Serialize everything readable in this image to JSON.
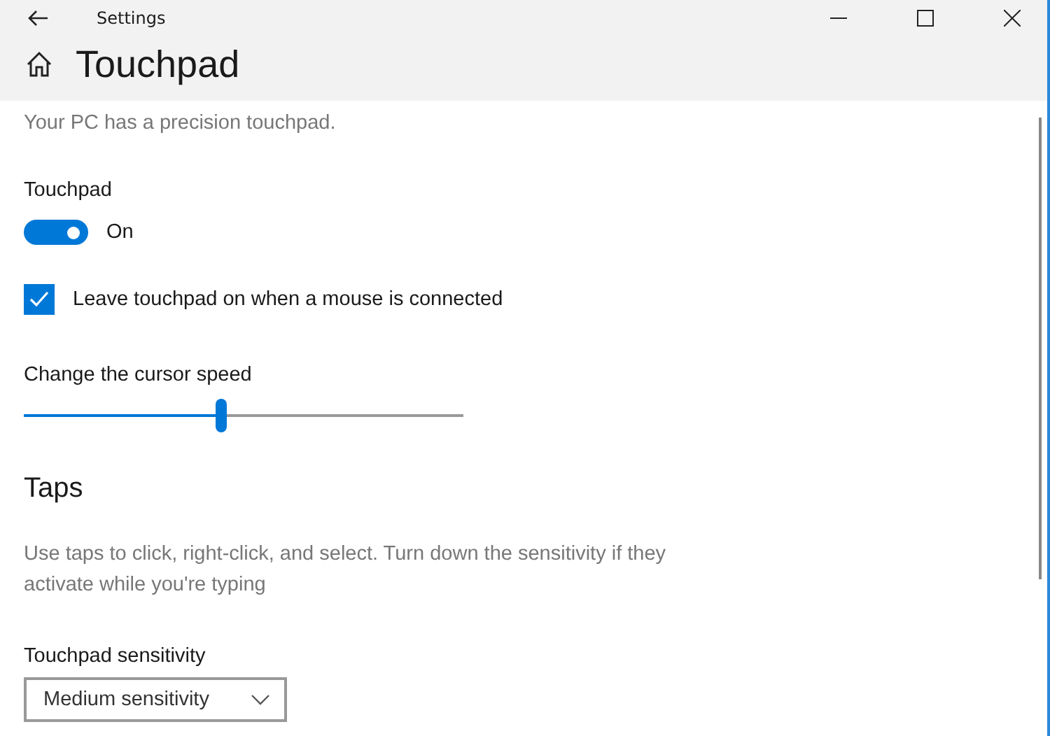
{
  "window": {
    "title": "Settings"
  },
  "page": {
    "title": "Touchpad",
    "intro": "Your PC has a precision touchpad."
  },
  "touchpad_toggle": {
    "label": "Touchpad",
    "on": true,
    "state_text": "On"
  },
  "leave_on": {
    "label": "Leave touchpad on when a mouse is connected",
    "checked": true
  },
  "cursor_speed": {
    "label": "Change the cursor speed",
    "level": 0.45
  },
  "taps": {
    "heading": "Taps",
    "description": "Use taps to click, right-click, and select. Turn down the sensitivity if they activate while you're typing",
    "sensitivity_label": "Touchpad sensitivity",
    "sensitivity_value": "Medium sensitivity"
  }
}
